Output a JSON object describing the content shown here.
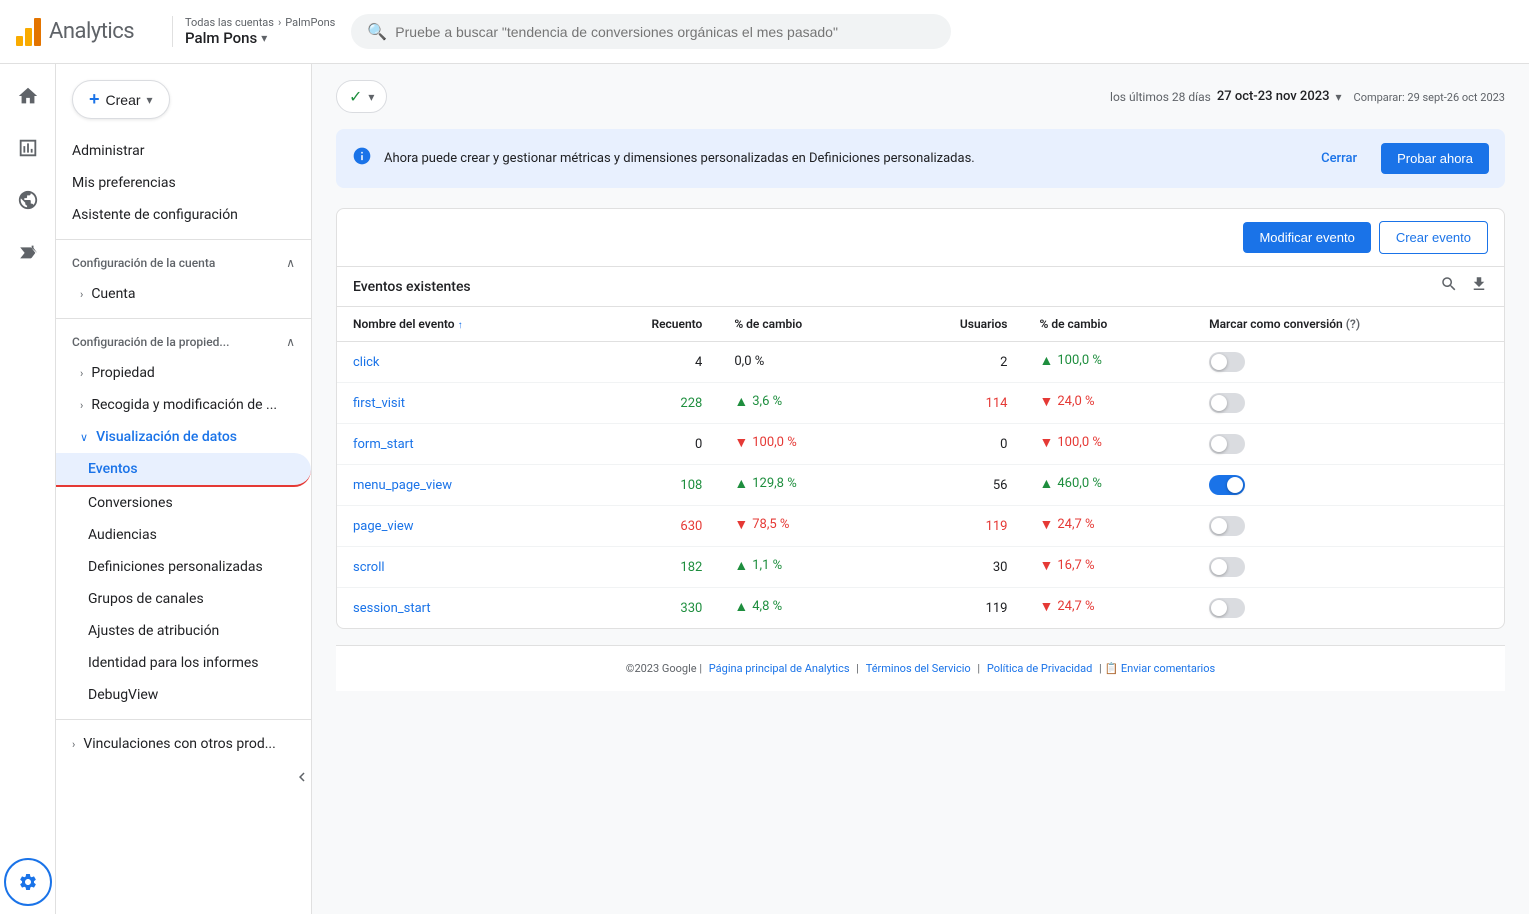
{
  "header": {
    "app_title": "Analytics",
    "breadcrumb_label": "Todas las cuentas",
    "breadcrumb_separator": "›",
    "breadcrumb_account": "PalmPons",
    "account_name": "Palm Pons",
    "chevron": "▾",
    "search_placeholder": "Pruebe a buscar \"tendencia de conversiones orgánicas el mes pasado\""
  },
  "icon_nav": {
    "home_icon": "⌂",
    "bar_chart_icon": "▦",
    "target_icon": "◎",
    "signal_icon": "◉"
  },
  "sidebar": {
    "create_label": "Crear",
    "create_plus": "+",
    "create_chevron": "▾",
    "menu_items": [
      {
        "id": "administrar",
        "label": "Administrar",
        "type": "link"
      },
      {
        "id": "mis-preferencias",
        "label": "Mis preferencias",
        "type": "link"
      },
      {
        "id": "asistente",
        "label": "Asistente de configuración",
        "type": "link"
      }
    ],
    "account_section": {
      "label": "Configuración de la cuenta",
      "arrow_open": "∧",
      "sub_items": [
        {
          "id": "cuenta",
          "label": "Cuenta",
          "arrow": "›"
        }
      ]
    },
    "property_section": {
      "label": "Configuración de la propied...",
      "arrow_open": "∧",
      "sub_items": [
        {
          "id": "propiedad",
          "label": "Propiedad",
          "arrow": "›"
        },
        {
          "id": "recogida",
          "label": "Recogida y modificación de ...",
          "arrow": "›"
        },
        {
          "id": "visualizacion",
          "label": "Visualización de datos",
          "arrow": "∨"
        }
      ]
    },
    "visualization_sub_items": [
      {
        "id": "eventos",
        "label": "Eventos",
        "active": true
      },
      {
        "id": "conversiones",
        "label": "Conversiones",
        "active": false
      },
      {
        "id": "audiencias",
        "label": "Audiencias",
        "active": false
      },
      {
        "id": "definiciones",
        "label": "Definiciones personalizadas",
        "active": false
      },
      {
        "id": "grupos",
        "label": "Grupos de canales",
        "active": false
      },
      {
        "id": "ajustes",
        "label": "Ajustes de atribución",
        "active": false
      },
      {
        "id": "identidad",
        "label": "Identidad para los informes",
        "active": false
      },
      {
        "id": "debugview",
        "label": "DebugView",
        "active": false
      }
    ],
    "vinculaciones": {
      "label": "Vinculaciones con otros prod...",
      "arrow": "›"
    }
  },
  "date_range": {
    "filter_chip_label": "✓ ▾",
    "period_label": "los últimos 28 días",
    "date_range": "27 oct-23 nov 2023",
    "compare_label": "Comparar: 29 sept-26 oct 2023",
    "chevron": "▾"
  },
  "info_banner": {
    "text": "Ahora puede crear y gestionar métricas y dimensiones personalizadas en Definiciones personalizadas.",
    "close_label": "Cerrar",
    "try_label": "Probar ahora"
  },
  "events_card": {
    "modify_btn": "Modificar evento",
    "create_btn": "Crear evento",
    "table_title": "Eventos existentes",
    "columns": {
      "event_name": "Nombre del evento",
      "sort_icon": "↑",
      "recuento": "Recuento",
      "pct_cambio_1": "% de cambio",
      "usuarios": "Usuarios",
      "pct_cambio_2": "% de cambio",
      "conversion": "Marcar como conversión"
    },
    "rows": [
      {
        "name": "click",
        "recuento": "4",
        "pct_cambio": "0,0 %",
        "pct_dir": "none",
        "usuarios": "2",
        "usuarios_num_color": "black",
        "u_pct": "100,0 %",
        "u_pct_dir": "up",
        "u_pct_color": "green",
        "conversion": false
      },
      {
        "name": "first_visit",
        "recuento": "228",
        "recuento_color": "green",
        "pct_cambio": "3,6 %",
        "pct_dir": "up",
        "pct_color": "green",
        "usuarios": "114",
        "usuarios_color": "red",
        "u_pct": "24,0 %",
        "u_pct_dir": "down",
        "u_pct_color": "red",
        "conversion": false
      },
      {
        "name": "form_start",
        "recuento": "0",
        "pct_cambio": "100,0 %",
        "pct_dir": "down",
        "pct_color": "red",
        "usuarios": "0",
        "u_pct": "100,0 %",
        "u_pct_dir": "down",
        "u_pct_color": "red",
        "conversion": false
      },
      {
        "name": "menu_page_view",
        "recuento": "108",
        "recuento_color": "green",
        "pct_cambio": "129,8 %",
        "pct_dir": "up",
        "pct_color": "green",
        "usuarios": "56",
        "u_pct": "460,0 %",
        "u_pct_dir": "up",
        "u_pct_color": "green",
        "conversion": true
      },
      {
        "name": "page_view",
        "recuento": "630",
        "recuento_color": "red",
        "pct_cambio": "78,5 %",
        "pct_dir": "down",
        "pct_color": "red",
        "usuarios": "119",
        "usuarios_color": "red",
        "u_pct": "24,7 %",
        "u_pct_dir": "down",
        "u_pct_color": "red",
        "conversion": false
      },
      {
        "name": "scroll",
        "recuento": "182",
        "recuento_color": "green",
        "pct_cambio": "1,1 %",
        "pct_dir": "up",
        "pct_color": "green",
        "usuarios": "30",
        "u_pct": "16,7 %",
        "u_pct_dir": "down",
        "u_pct_color": "red",
        "conversion": false
      },
      {
        "name": "session_start",
        "recuento": "330",
        "recuento_color": "green",
        "pct_cambio": "4,8 %",
        "pct_dir": "up",
        "pct_color": "green",
        "usuarios": "119",
        "u_pct": "24,7 %",
        "u_pct_dir": "down",
        "u_pct_color": "red",
        "conversion": false
      }
    ]
  },
  "footer": {
    "copyright": "©2023 Google",
    "links": [
      "Página principal de Analytics",
      "Términos del Servicio",
      "Política de Privacidad",
      "Enviar comentarios"
    ]
  }
}
